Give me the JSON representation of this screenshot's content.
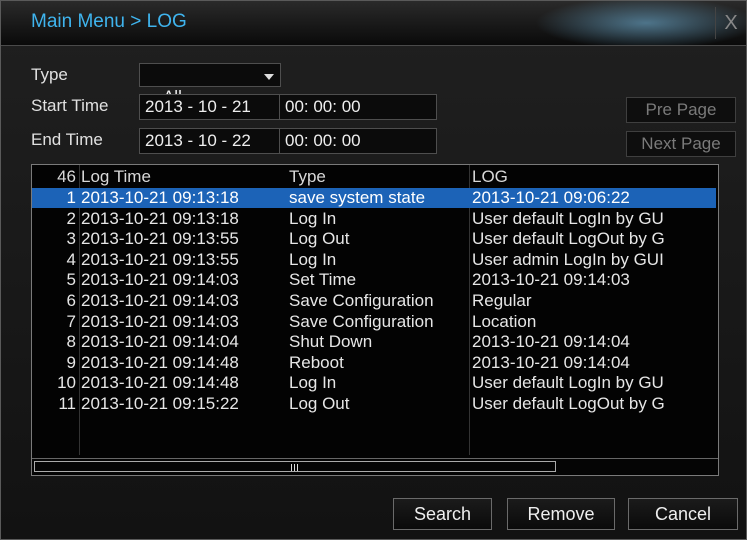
{
  "window": {
    "title": "Main Menu > LOG",
    "close_glyph": "X"
  },
  "filters": {
    "type_label": "Type",
    "type_value": "All",
    "start_label": "Start Time",
    "start_date": "2013 - 10 - 21",
    "start_time": "00: 00: 00",
    "end_label": "End Time",
    "end_date": "2013 - 10 - 22",
    "end_time": "00: 00: 00"
  },
  "paging": {
    "pre_label": "Pre Page",
    "next_label": "Next Page"
  },
  "table": {
    "header": {
      "count": "46",
      "time": "Log Time",
      "type": "Type",
      "log": "LOG"
    },
    "selected_index": 0,
    "rows": [
      {
        "num": "1",
        "time": "2013-10-21 09:13:18",
        "type": "save system state",
        "log": "2013-10-21 09:06:22"
      },
      {
        "num": "2",
        "time": "2013-10-21 09:13:18",
        "type": "Log In",
        "log": "User default LogIn by GU"
      },
      {
        "num": "3",
        "time": "2013-10-21 09:13:55",
        "type": "Log Out",
        "log": "User default LogOut by G"
      },
      {
        "num": "4",
        "time": "2013-10-21 09:13:55",
        "type": "Log In",
        "log": "User admin LogIn by GUI"
      },
      {
        "num": "5",
        "time": "2013-10-21 09:14:03",
        "type": "Set Time",
        "log": "2013-10-21 09:14:03"
      },
      {
        "num": "6",
        "time": "2013-10-21 09:14:03",
        "type": "Save Configuration",
        "log": "Regular"
      },
      {
        "num": "7",
        "time": "2013-10-21 09:14:03",
        "type": "Save Configuration",
        "log": "Location"
      },
      {
        "num": "8",
        "time": "2013-10-21 09:14:04",
        "type": "Shut Down",
        "log": "2013-10-21 09:14:04"
      },
      {
        "num": "9",
        "time": "2013-10-21 09:14:48",
        "type": "Reboot",
        "log": "2013-10-21 09:14:04"
      },
      {
        "num": "10",
        "time": "2013-10-21 09:14:48",
        "type": "Log In",
        "log": "User default LogIn by GU"
      },
      {
        "num": "11",
        "time": "2013-10-21 09:15:22",
        "type": "Log Out",
        "log": "User default LogOut by G"
      }
    ]
  },
  "actions": {
    "search": "Search",
    "remove": "Remove",
    "cancel": "Cancel"
  },
  "colors": {
    "title": "#3fb4ee",
    "selection": "#1c63b7",
    "background": "#121212"
  }
}
